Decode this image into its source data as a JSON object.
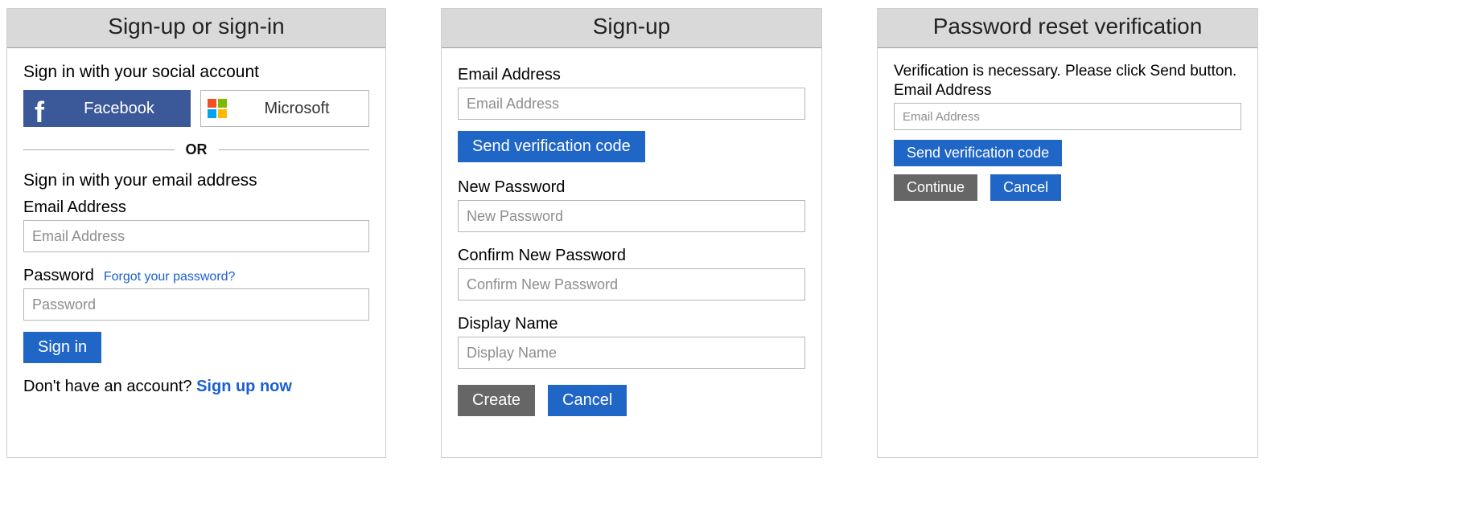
{
  "panel1": {
    "title": "Sign-up or sign-in",
    "social_heading": "Sign in with your social account",
    "facebook_label": "Facebook",
    "microsoft_label": "Microsoft",
    "divider_text": "OR",
    "local_heading": "Sign in with your email address",
    "email_label": "Email Address",
    "email_placeholder": "Email Address",
    "password_label": "Password",
    "forgot_link": "Forgot your password?",
    "password_placeholder": "Password",
    "signin_button": "Sign in",
    "no_account_text": "Don't have an account? ",
    "signup_link": "Sign up now"
  },
  "panel2": {
    "title": "Sign-up",
    "email_label": "Email Address",
    "email_placeholder": "Email Address",
    "send_code_button": "Send verification code",
    "new_password_label": "New Password",
    "new_password_placeholder": "New Password",
    "confirm_password_label": "Confirm New Password",
    "confirm_password_placeholder": "Confirm New Password",
    "display_name_label": "Display Name",
    "display_name_placeholder": "Display Name",
    "create_button": "Create",
    "cancel_button": "Cancel"
  },
  "panel3": {
    "title": "Password reset verification",
    "instruction": "Verification is necessary. Please click Send button.",
    "email_label": "Email Address",
    "email_placeholder": "Email Address",
    "send_code_button": "Send verification code",
    "continue_button": "Continue",
    "cancel_button": "Cancel"
  }
}
